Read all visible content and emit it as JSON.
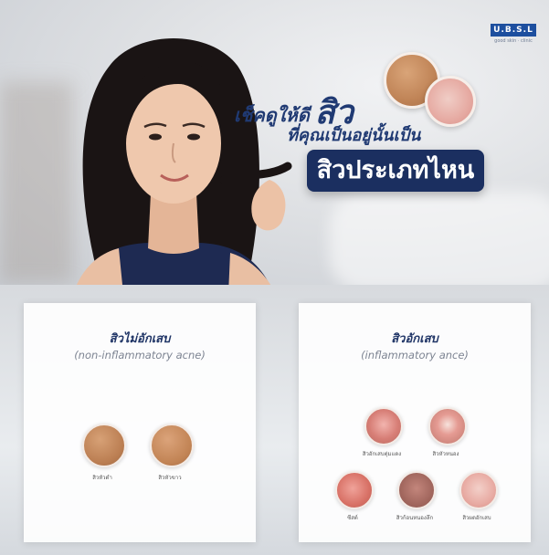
{
  "brand": {
    "logo_text": "U.B.S.L",
    "tagline": "good  skin  ·  clinic"
  },
  "banner": {
    "headline_line1_prefix": "เช็คดูให้ดี",
    "headline_line1_emphasis": "สิว",
    "headline_line2": "ที่คุณเป็นอยู่นั้นเป็น",
    "headline_pill": "สิวประเภทไหน"
  },
  "panels": {
    "non_inflammatory": {
      "title": "สิวไม่อักเสบ",
      "subtitle": "(non-inflammatory acne)",
      "items": [
        "สิวหัวดำ",
        "สิวหัวขาว"
      ]
    },
    "inflammatory": {
      "title": "สิวอักเสบ",
      "subtitle": "(inflammatory ance)",
      "items": [
        "สิวอักเสบตุ่มแดง",
        "สิวหัวหนอง",
        "ซีสต์",
        "สิวก้อนหนองลึก",
        "สิวผดอักเสบ"
      ]
    }
  },
  "colors": {
    "navy": "#1b2f60",
    "title_blue": "#203a73",
    "skin_tan": "#c58a5e",
    "skin_pink": "#e7b2a8"
  }
}
